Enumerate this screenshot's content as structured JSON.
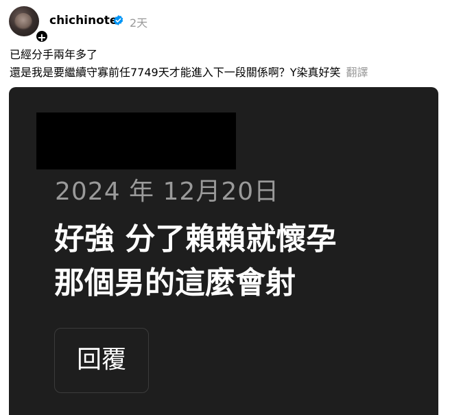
{
  "post": {
    "username": "chichinote",
    "time": "2天",
    "caption": {
      "line1": "已經分手兩年多了",
      "line2": "還是我是要繼續守寡前任7749天才能進入下一段關係啊？Y染真好笑",
      "translate_label": "翻譯"
    }
  },
  "card": {
    "date": "2024 年 12月20日",
    "comment_line1": "好強 分了賴賴就懷孕",
    "comment_line2": "那個男的這麼會射",
    "reply_label": "回覆"
  },
  "icons": {
    "verified": "verified-badge-icon",
    "follow": "plus-icon"
  },
  "colors": {
    "verified": "#0095f6",
    "card_bg": "#1e1e1e",
    "muted": "#999999"
  }
}
